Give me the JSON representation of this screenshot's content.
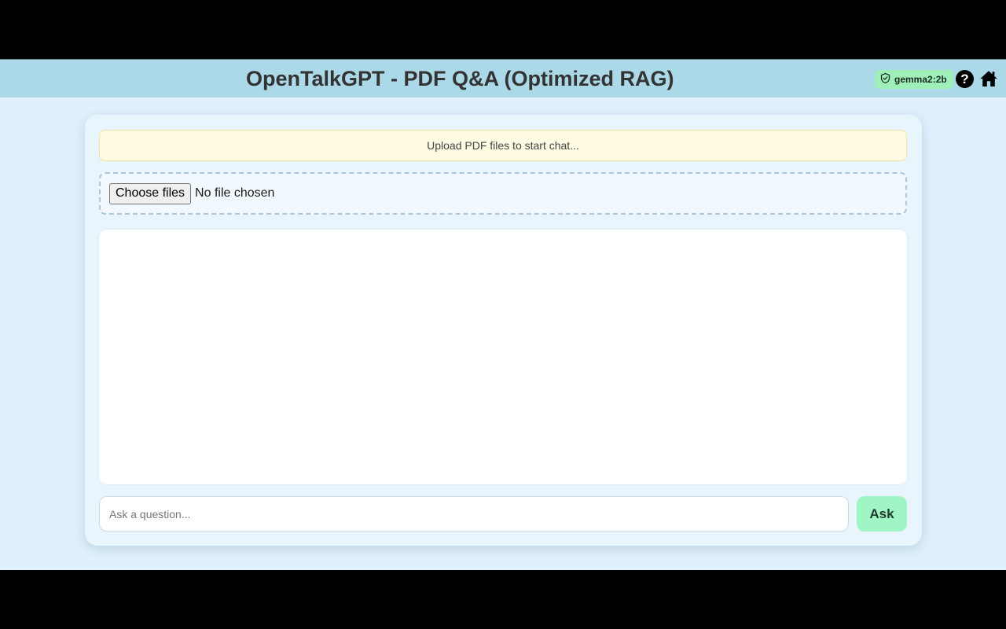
{
  "header": {
    "title": "OpenTalkGPT - PDF Q&A (Optimized RAG)",
    "model_badge": "gemma2:2b",
    "help_label": "?"
  },
  "main": {
    "status_message": "Upload PDF files to start chat...",
    "upload": {
      "button_label": "Choose files",
      "file_status": "No file chosen"
    },
    "question": {
      "placeholder": "Ask a question...",
      "value": ""
    },
    "ask_label": "Ask"
  },
  "icons": {
    "model": "shield-check-icon",
    "help": "question-icon",
    "home": "home-icon"
  },
  "colors": {
    "header_bg": "#abd9e8",
    "page_bg": "#e0f0fc",
    "badge_bg": "#9ef0b8",
    "ask_bg": "#9ff5c3",
    "banner_bg": "#fefbe2"
  }
}
